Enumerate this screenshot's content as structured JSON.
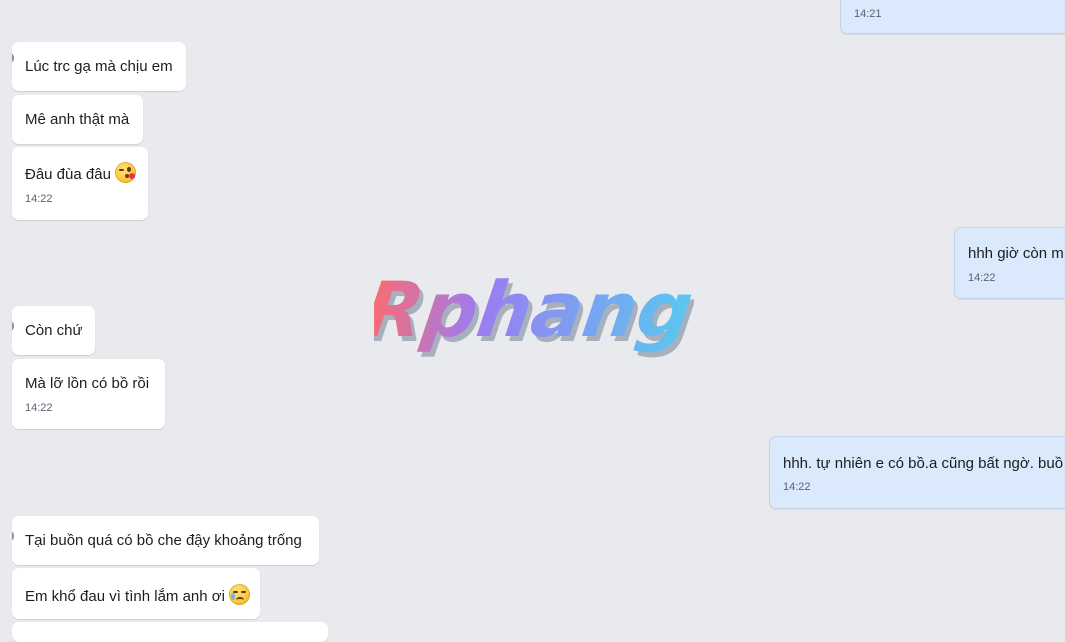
{
  "brand": {
    "watermark": "Rphang",
    "colors": {
      "left": "#ff6b6b",
      "mid": "#9b7cf2",
      "right": "#59c8f0"
    }
  },
  "messages": [
    {
      "text": "",
      "time": "14:21"
    },
    {
      "text": "Lúc trc gạ mà chịu em"
    },
    {
      "text": "Mê anh thật mà"
    },
    {
      "text": "Đâu đùa đâu",
      "emoji": "kissing-face-emoji",
      "time": "14:22"
    },
    {
      "text": "hhh giờ còn m",
      "time": "14:22"
    },
    {
      "text": "Còn chứ"
    },
    {
      "text": "Mà lỡ lồn có bồ rồi",
      "time": "14:22"
    },
    {
      "text": "hhh. tự nhiên e có bồ.a cũng bất ngờ. buồ",
      "time": "14:22"
    },
    {
      "text": "Tại buồn quá có bồ che đậy khoảng trống"
    },
    {
      "text": "Em khổ đau vì tình lắm anh ơi",
      "emoji": "crying-face-emoji"
    }
  ],
  "colors": {
    "background": "#e9eaee",
    "incoming_bubble": "#ffffff",
    "outgoing_bubble": "#dbe9fd",
    "timestamp": "#5a6170"
  }
}
